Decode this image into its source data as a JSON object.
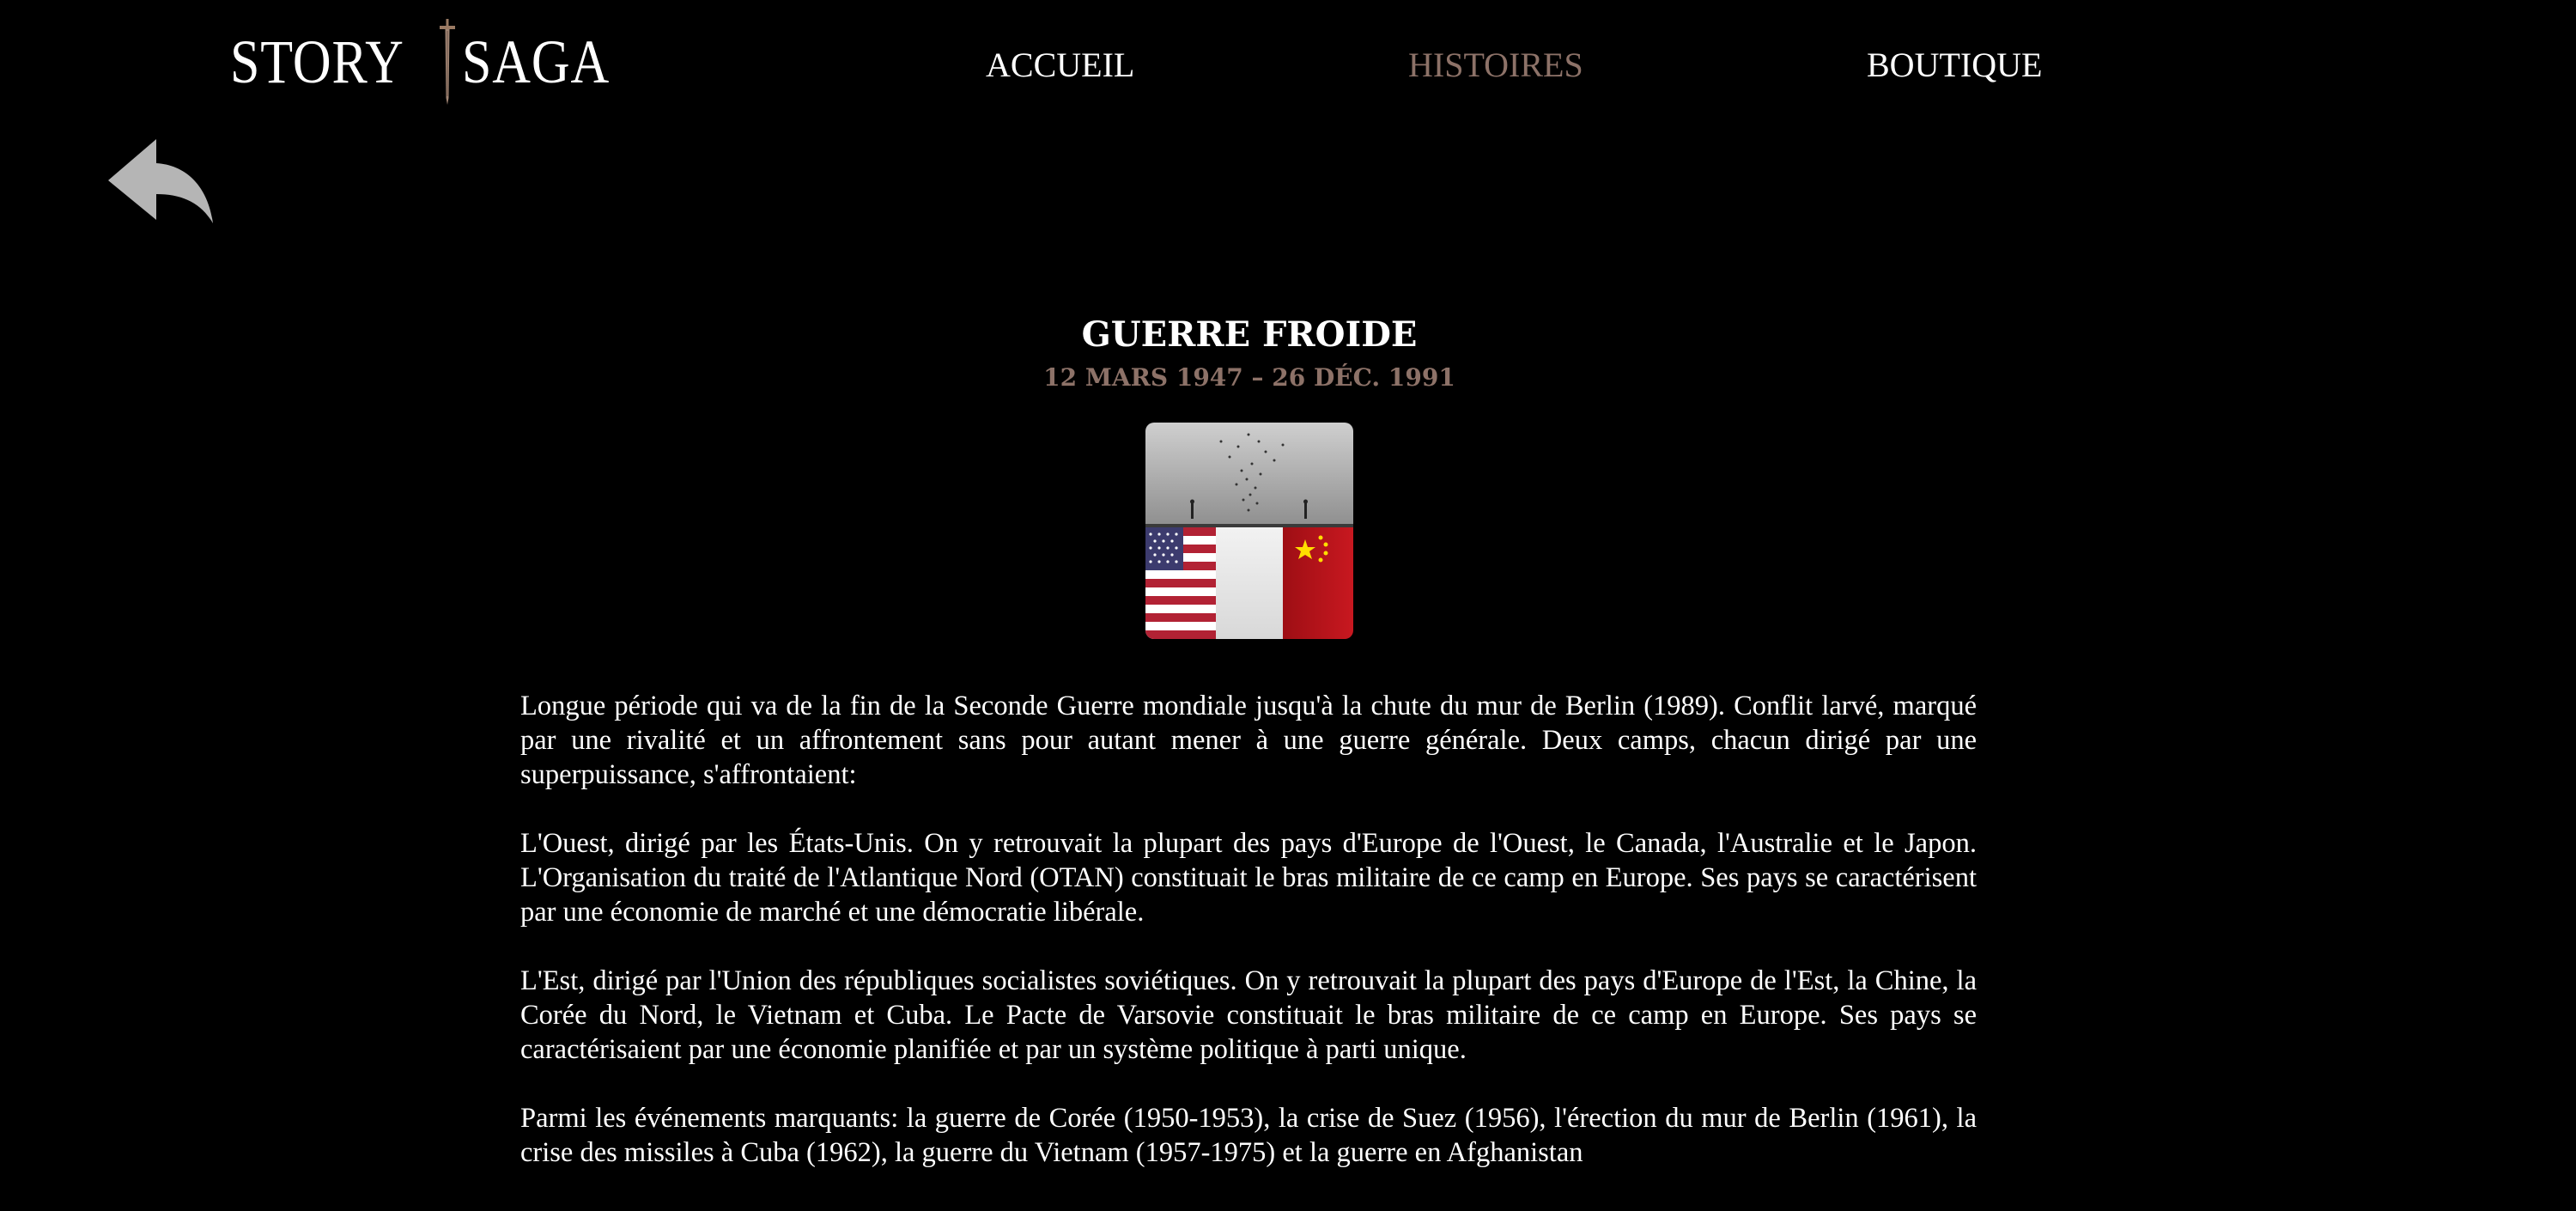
{
  "header": {
    "logo_left": "STORY",
    "logo_right": "SAGA",
    "nav": [
      {
        "label": "ACCUEIL",
        "active": false
      },
      {
        "label": "HISTOIRES",
        "active": true
      },
      {
        "label": "BOUTIQUE",
        "active": false
      }
    ]
  },
  "icons": {
    "back": "reply-arrow-icon",
    "logo_separator": "sword-icon"
  },
  "colors": {
    "background": "#000000",
    "text": "#ffffff",
    "accent": "#8d7268",
    "back_icon": "#b5b5b5"
  },
  "story": {
    "title": "GUERRE FROIDE",
    "dates": "12 MARS 1947 – 26 DÉC. 1991",
    "paragraphs": [
      "Longue période qui va de la fin de la Seconde Guerre mondiale jusqu'à la chute du mur de Berlin (1989). Conflit larvé, marqué par une rivalité et un affrontement sans pour autant mener à une guerre générale. Deux camps, chacun dirigé par une superpuissance, s'affrontaient:",
      "L'Ouest, dirigé par les États-Unis. On y retrouvait la plupart des pays d'Europe de l'Ouest, le Canada, l'Australie et le Japon. L'Organisation du traité de l'Atlantique Nord (OTAN) constituait le bras militaire de ce camp en Europe. Ses pays se caractérisent par une économie de marché et une démocratie libérale.",
      "L'Est, dirigé par l'Union des républiques socialistes soviétiques. On y retrouvait la plupart des pays d'Europe de l'Est, la Chine, la Corée du Nord, le Vietnam et Cuba. Le Pacte de Varsovie constituait le bras militaire de ce camp en Europe. Ses pays se caractérisaient par une économie planifiée et par un système politique à parti unique.",
      "Parmi les événements marquants: la guerre de Corée (1950-1953), la crise de Suez (1956), l'érection du mur de Berlin (1961), la crise des missiles à Cuba (1962), la guerre du Vietnam (1957-1975) et la guerre en Afghanistan"
    ]
  }
}
